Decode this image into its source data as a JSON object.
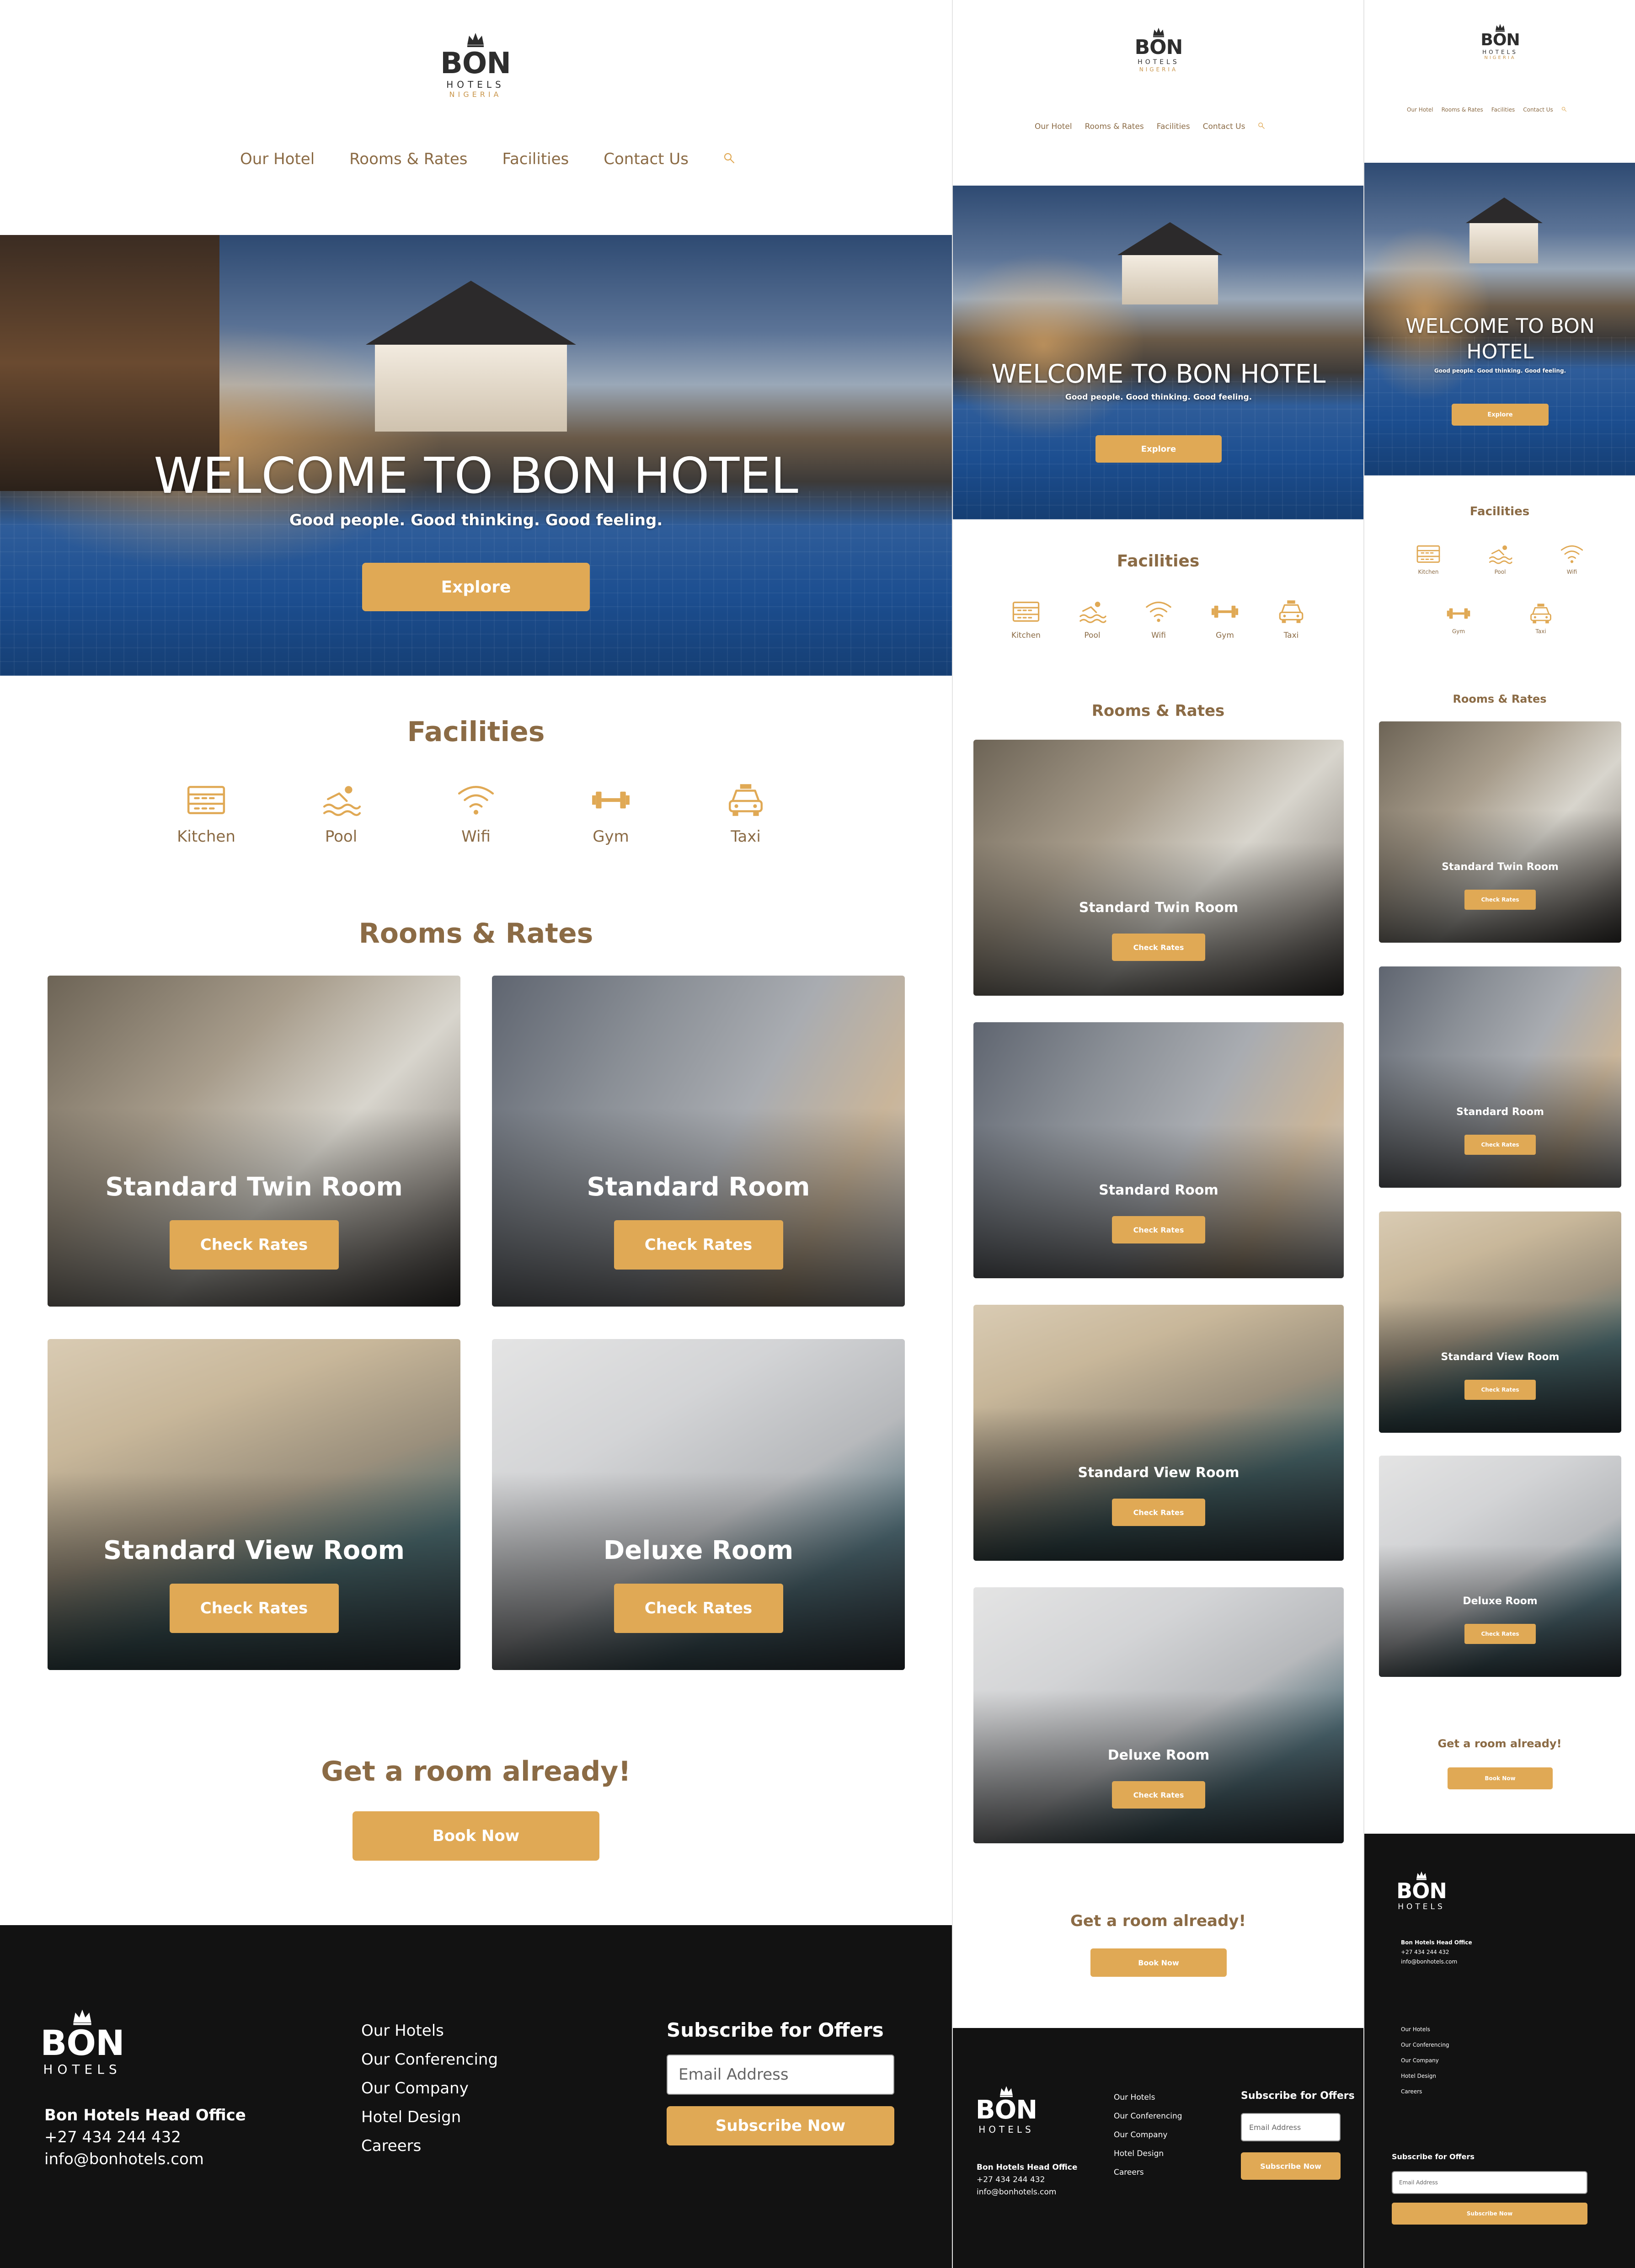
{
  "brand": {
    "name": "BON",
    "sub": "HOTELS",
    "country": "NIGERIA",
    "accent_color": "#e0a955",
    "text_brown": "#8b6b45",
    "footer_bg": "#121212"
  },
  "nav": {
    "items": [
      "Our Hotel",
      "Rooms & Rates",
      "Facilities",
      "Contact Us"
    ],
    "search_icon": "search-icon"
  },
  "hero": {
    "title": "WELCOME TO BON HOTEL",
    "title_mobile_1": "WELCOME TO BON",
    "title_mobile_2": "HOTEL",
    "subtitle": "Good people. Good thinking. Good feeling.",
    "button": "Explore"
  },
  "facilities": {
    "title": "Facilities",
    "items": [
      {
        "label": "Kitchen",
        "icon": "kitchen-icon"
      },
      {
        "label": "Pool",
        "icon": "pool-icon"
      },
      {
        "label": "Wifi",
        "icon": "wifi-icon"
      },
      {
        "label": "Gym",
        "icon": "gym-icon"
      },
      {
        "label": "Taxi",
        "icon": "taxi-icon"
      }
    ]
  },
  "rooms": {
    "title": "Rooms & Rates",
    "button": "Check Rates",
    "items": [
      {
        "name": "Standard Twin Room"
      },
      {
        "name": "Standard Room"
      },
      {
        "name": "Standard View Room"
      },
      {
        "name": "Deluxe Room"
      }
    ]
  },
  "cta": {
    "title": "Get a room already!",
    "button": "Book Now"
  },
  "footer": {
    "office_title": "Bon Hotels Head Office",
    "phone": "+27 434 244 432",
    "email": "info@bonhotels.com",
    "links": [
      "Our Hotels",
      "Our Conferencing",
      "Our Company",
      "Hotel Design",
      "Careers"
    ],
    "subscribe_title": "Subscribe for Offers",
    "email_placeholder": "Email Address",
    "subscribe_button": "Subscribe Now"
  }
}
